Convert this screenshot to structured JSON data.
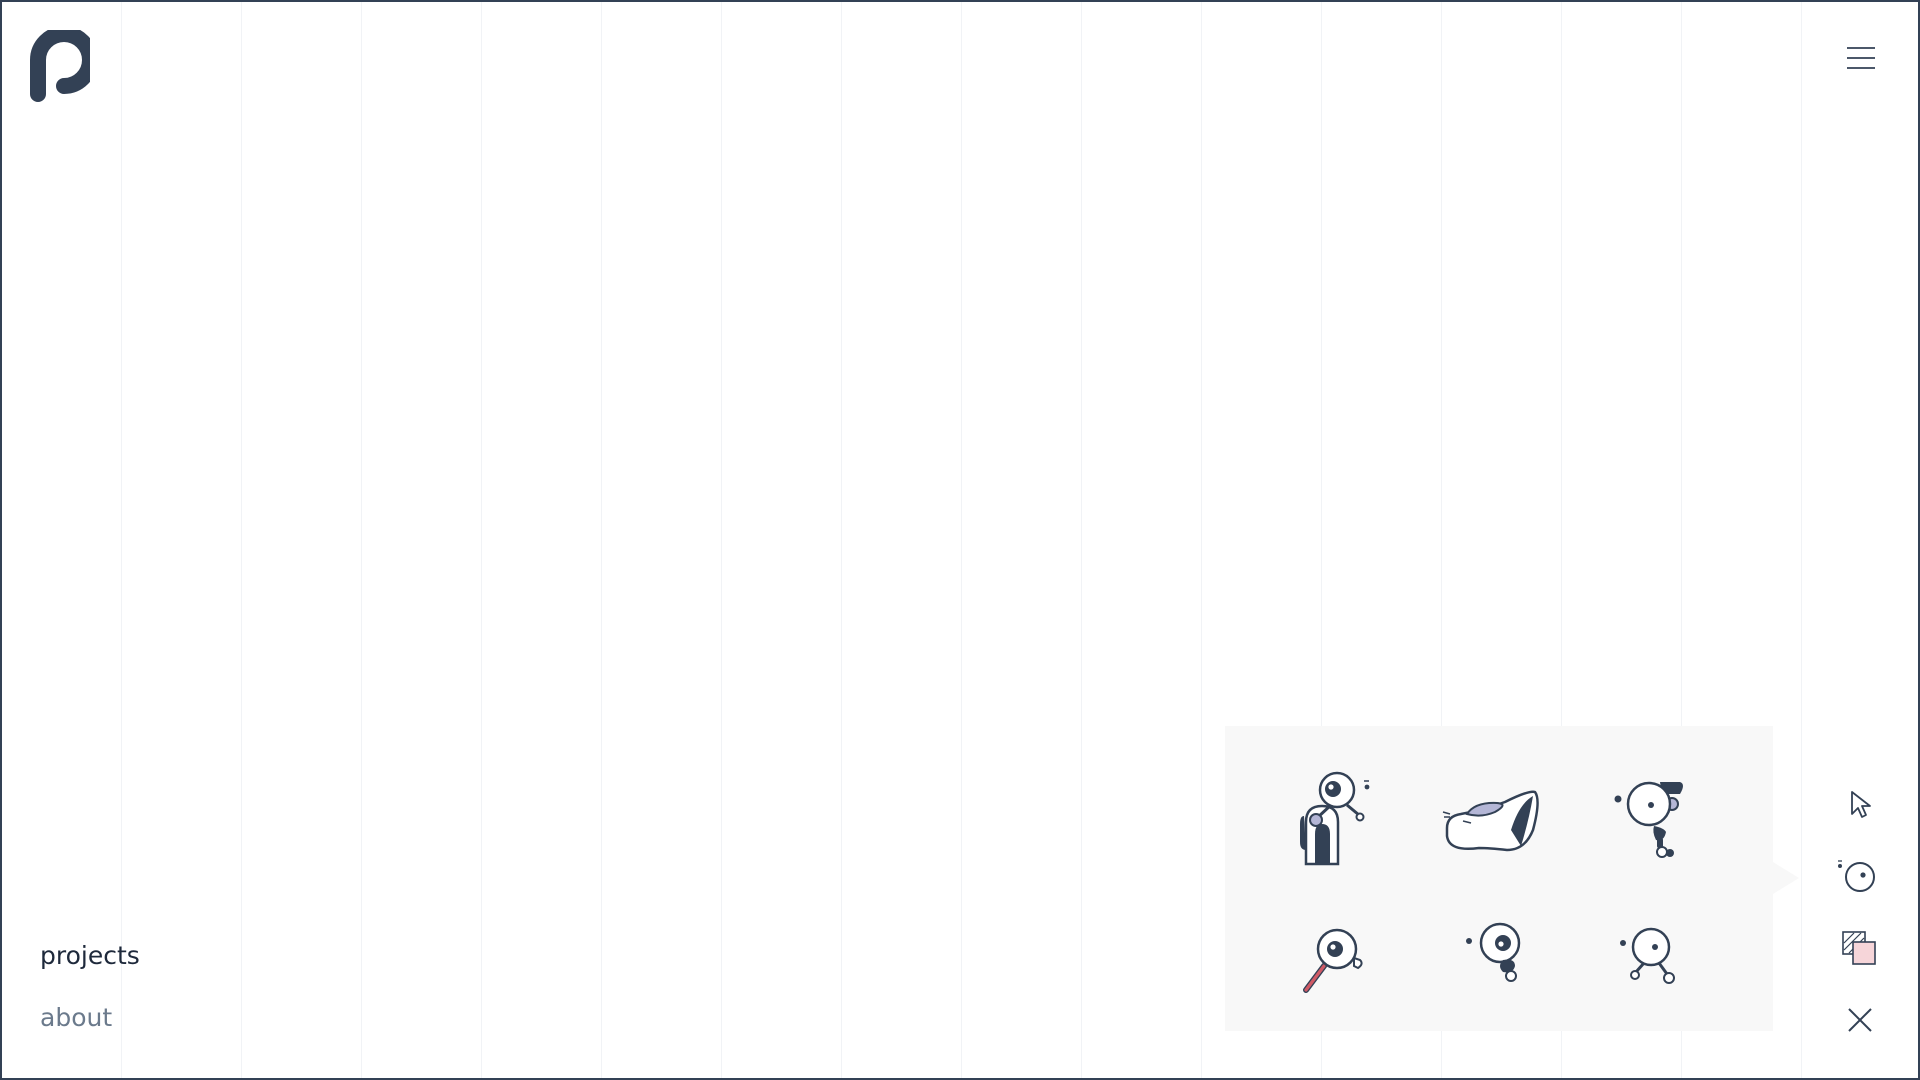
{
  "nav": {
    "items": [
      {
        "label": "projects",
        "active": true
      },
      {
        "label": "about",
        "active": false
      }
    ]
  },
  "colors": {
    "ink": "#334155",
    "frame": "#334155",
    "panel": "#f8f8f8",
    "accent_lavender": "#b4b6d6",
    "accent_red": "#d05a66",
    "accent_pink": "#f6d5d9"
  },
  "icons": {
    "logo": "p-logo-icon",
    "menu": "hamburger-menu-icon",
    "grid": [
      "eye-creature-arch-icon",
      "shoe-creature-icon",
      "eye-creature-bow-icon",
      "magnifier-eye-icon",
      "eye-creature-dot-icon",
      "eye-creature-feet-icon"
    ],
    "toolbar": [
      "cursor-icon",
      "eye-icon",
      "layers-color-icon",
      "close-icon"
    ]
  }
}
